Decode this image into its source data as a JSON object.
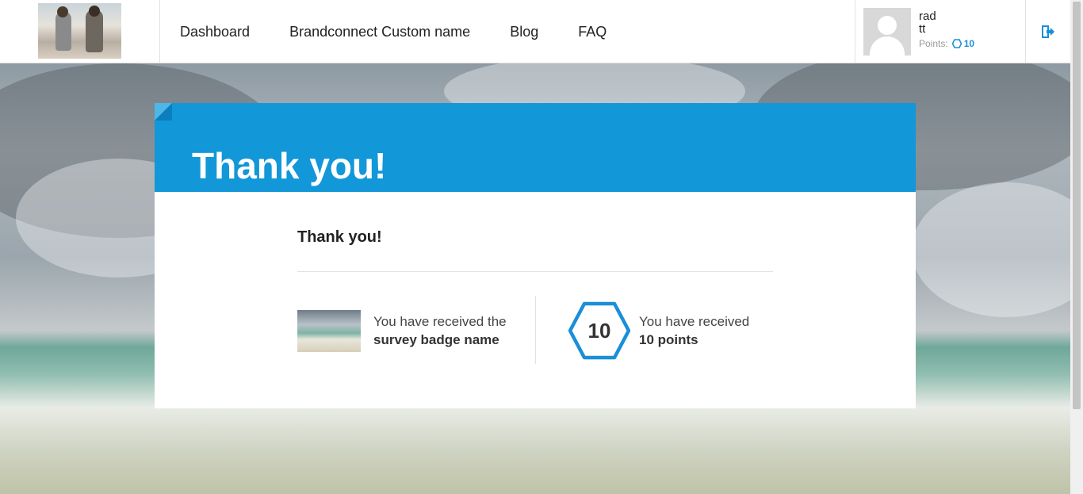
{
  "nav": {
    "items": [
      {
        "label": "Dashboard"
      },
      {
        "label": "Brandconnect Custom name"
      },
      {
        "label": "Blog"
      },
      {
        "label": "FAQ"
      }
    ]
  },
  "user": {
    "first_name": "rad",
    "last_name": "tt",
    "points_label": "Points:",
    "points_value": "10",
    "icons": {
      "points": "hexagon-icon",
      "logout": "logout-icon",
      "avatar": "avatar-placeholder-icon"
    }
  },
  "card": {
    "header_title": "Thank you!",
    "subtitle": "Thank you!",
    "badge": {
      "line1": "You have received the",
      "line2": "survey badge name"
    },
    "points": {
      "number": "10",
      "line1": "You have received",
      "line2": "10 points"
    }
  },
  "colors": {
    "accent": "#1297d9",
    "points_blue": "#1a8fd8"
  }
}
